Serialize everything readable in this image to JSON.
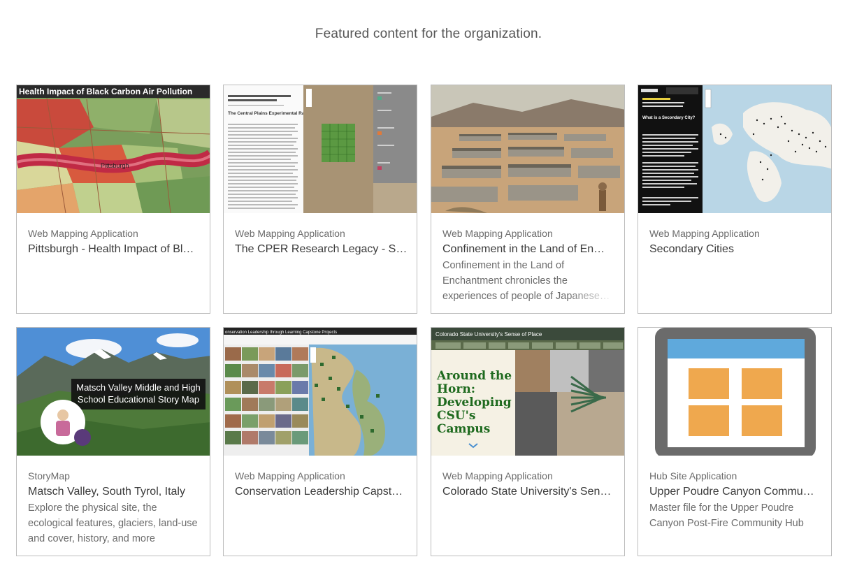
{
  "header": {
    "subtitle": "Featured content for the organization."
  },
  "cards": [
    {
      "type": "Web Mapping Application",
      "title": "Pittsburgh - Health Impact of Bl…",
      "description": "",
      "thumb_text": {
        "banner": "Health Impact of Black Carbon Air Pollution",
        "label": "Pittsburgh"
      }
    },
    {
      "type": "Web Mapping Application",
      "title": "The CPER Research Legacy - Sh…",
      "description": "",
      "thumb_text": {
        "heading": "The Central Plains Experimental Range"
      }
    },
    {
      "type": "Web Mapping Application",
      "title": "Confinement in the Land of En…",
      "description": "Confinement in the Land of Enchantment chronicles the experiences of people of Japanese…"
    },
    {
      "type": "Web Mapping Application",
      "title": "Secondary Cities",
      "description": "",
      "thumb_text": {
        "heading": "What is a Secondary City?"
      }
    },
    {
      "type": "StoryMap",
      "title": "Matsch Valley, South Tyrol, Italy",
      "description": "Explore the physical site, the ecological features, glaciers, land-use and cover, history, and more",
      "thumb_text": {
        "line1": "Matsch Valley Middle and High",
        "line2": "School Educational Story Map"
      }
    },
    {
      "type": "Web Mapping Application",
      "title": "Conservation Leadership Capst…",
      "description": "",
      "thumb_text": {
        "banner": "onservation Leadership through Learning Capstone Projects"
      }
    },
    {
      "type": "Web Mapping Application",
      "title": "Colorado State University's Sen…",
      "description": "",
      "thumb_text": {
        "banner": "Colorado State University's Sense of Place",
        "l1": "Around the",
        "l2": "Horn:",
        "l3": "Developing",
        "l4": "CSU's",
        "l5": "Campus"
      }
    },
    {
      "type": "Hub Site Application",
      "title": "Upper Poudre Canyon Commu…",
      "description": "Master file for the Upper Poudre Canyon Post-Fire Community Hub"
    }
  ]
}
